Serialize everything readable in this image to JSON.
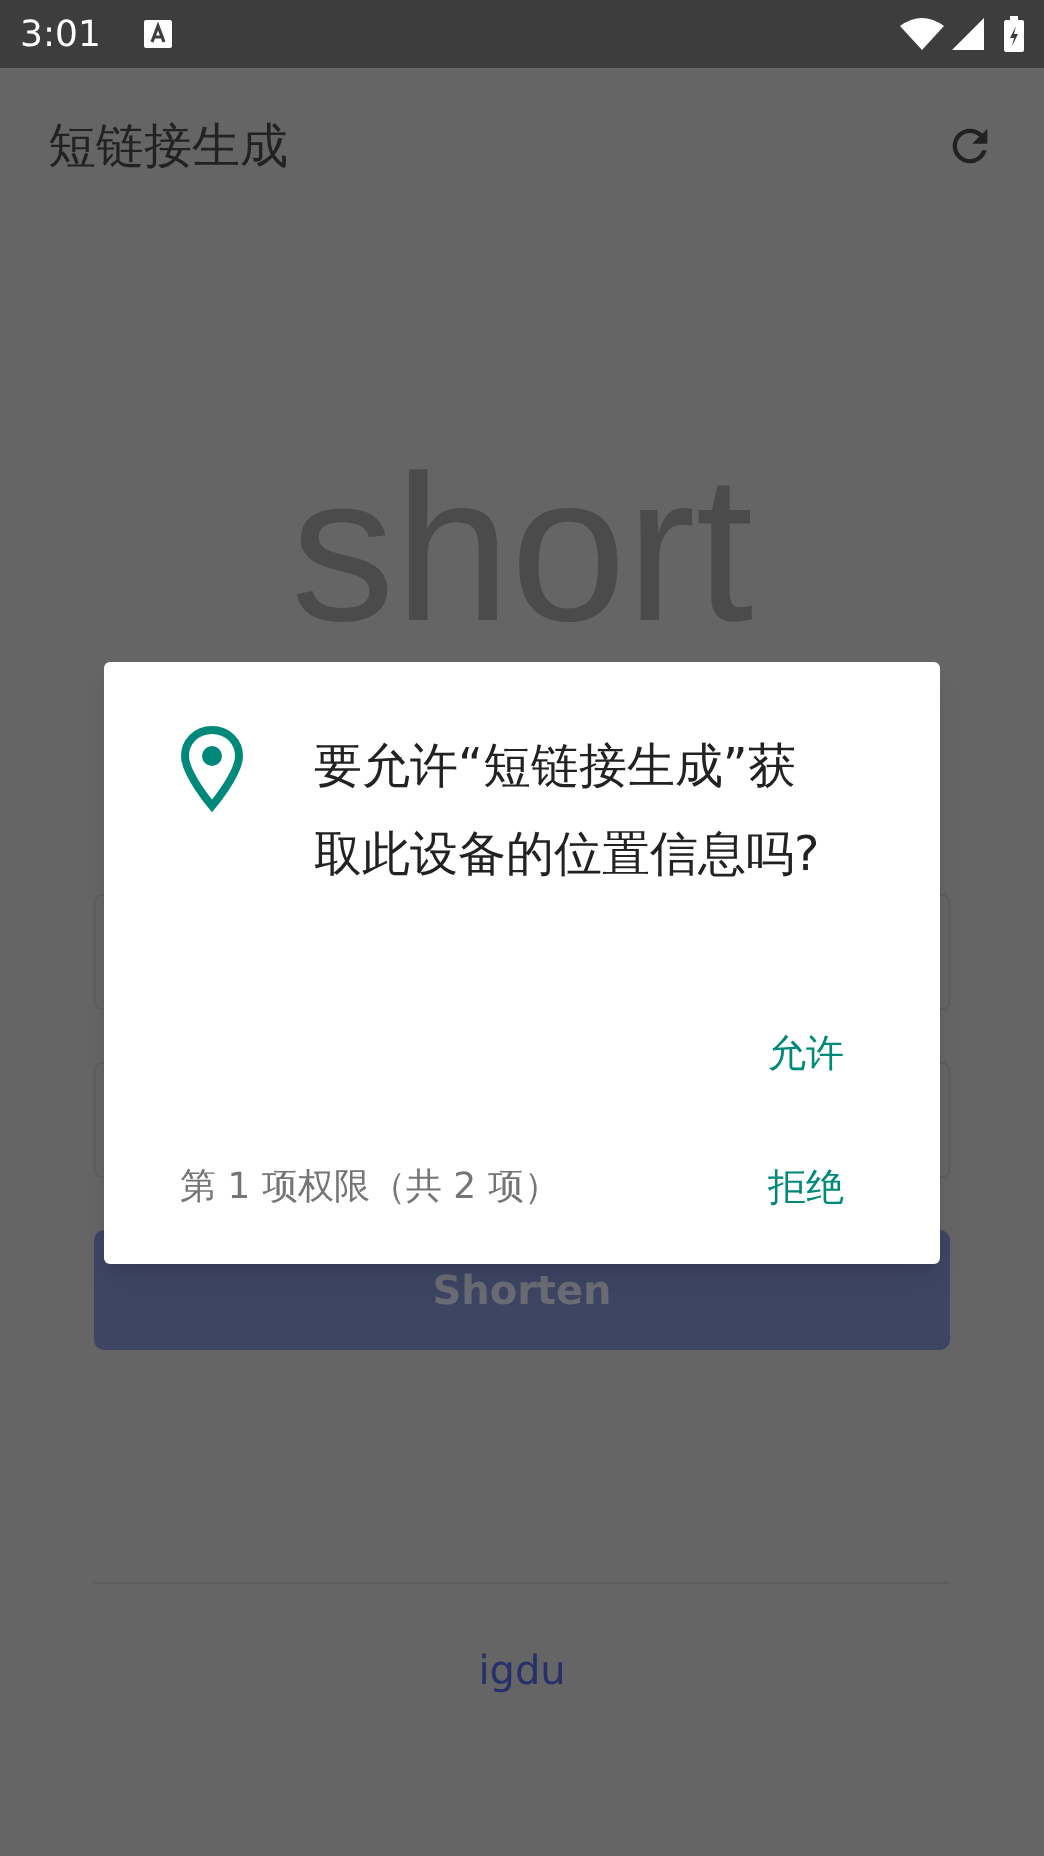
{
  "status_bar": {
    "time": "3:01"
  },
  "app_bar": {
    "title": "短链接生成"
  },
  "hero": {
    "text": "short"
  },
  "shorten_button": {
    "label": "Shorten",
    "disabled": true
  },
  "footer": {
    "text": "igdu"
  },
  "dialog": {
    "message": "要允许“短链接生成”获取此设备的位置信息吗?",
    "progress": "第 1 项权限（共 2 项）",
    "buttons": [
      {
        "label": "允许"
      },
      {
        "label": "拒绝"
      }
    ]
  }
}
